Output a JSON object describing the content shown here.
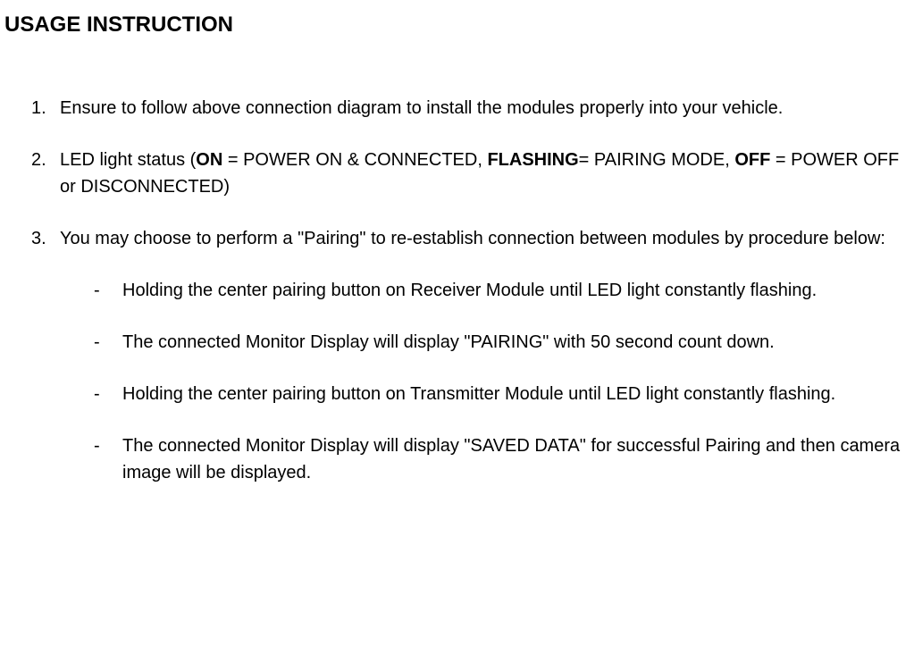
{
  "title": "USAGE INSTRUCTION",
  "items": [
    {
      "num": "1.",
      "text": "Ensure to follow above connection diagram to install the modules properly into your vehicle."
    },
    {
      "num": "2.",
      "parts": [
        {
          "text": "LED light status (",
          "bold": false
        },
        {
          "text": "ON",
          "bold": true
        },
        {
          "text": " = POWER ON & CONNECTED, ",
          "bold": false
        },
        {
          "text": "FLASHING",
          "bold": true
        },
        {
          "text": "= PAIRING MODE, ",
          "bold": false
        },
        {
          "text": "OFF",
          "bold": true
        },
        {
          "text": " = POWER OFF or DISCONNECTED)",
          "bold": false
        }
      ]
    },
    {
      "num": "3.",
      "text": "You may choose to perform a \"Pairing\" to re-establish connection between modules by procedure below:",
      "sub": [
        "Holding the center pairing button on Receiver Module until LED light constantly flashing.",
        "The connected Monitor Display will display \"PAIRING\" with 50 second count down.",
        "Holding the center pairing button on Transmitter Module until LED light constantly flashing.",
        "The connected Monitor Display will display \"SAVED DATA\" for successful Pairing and then camera image will be displayed."
      ]
    }
  ]
}
